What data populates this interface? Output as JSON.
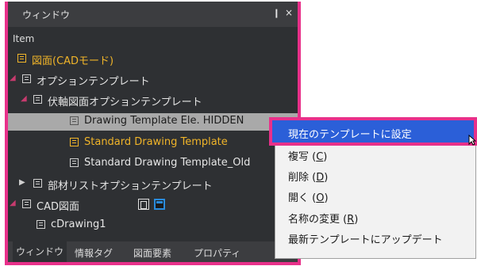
{
  "window": {
    "title": "ウィンドウ",
    "pin_glyph": "❙",
    "close_glyph": "×"
  },
  "column_header": "Item",
  "tree": [
    {
      "label": "図面(CADモード)",
      "icon": "drawing-icon",
      "color": "#f0b429"
    },
    {
      "label": "オプションテンプレート",
      "icon": "template-icon",
      "expanded": true
    },
    {
      "label": "伏軸図面オプションテンプレート",
      "icon": "template-icon",
      "expanded": true
    },
    {
      "label": "Drawing Template Ele. HIDDEN",
      "icon": "template-icon",
      "selected": true
    },
    {
      "label": "Standard Drawing Template",
      "icon": "template-icon",
      "color": "#f0b429"
    },
    {
      "label": "Standard Drawing Template_Old",
      "icon": "template-icon"
    },
    {
      "label": "部材リストオプションテンプレート",
      "icon": "template-icon",
      "expanded": false
    },
    {
      "label": "CAD図面",
      "icon": "cad-drawing-icon",
      "expanded": true
    },
    {
      "label": "cDrawing1",
      "icon": "cad-drawing-icon"
    }
  ],
  "tabs": [
    "ウィンドウ",
    "情報タグ",
    "図面要素",
    "プロパティ"
  ],
  "tabs_more": "◀ ▶",
  "context_menu": {
    "highlighted": "現在のテンプレートに設定",
    "items": [
      {
        "text": "複写 (",
        "key": "C",
        "end": ")"
      },
      {
        "text": "削除 (",
        "key": "D",
        "end": ")"
      },
      {
        "text": "開く (",
        "key": "O",
        "end": ")"
      },
      {
        "text": "名称の変更 (",
        "key": "R",
        "end": ")"
      },
      {
        "text": "最新テンプレートにアップデート",
        "key": "",
        "end": ""
      }
    ]
  },
  "colors": {
    "accent_border": "#e8308a",
    "highlight_blue": "#2b5fd8",
    "gold": "#f0b429"
  }
}
